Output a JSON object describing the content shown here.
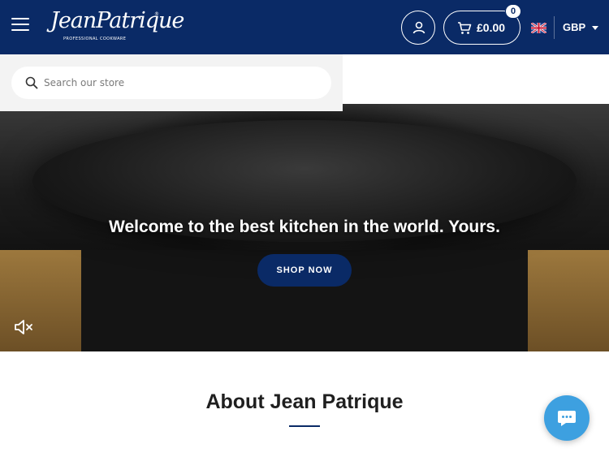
{
  "header": {
    "logo_text": "JeanPatrique",
    "logo_subtitle": "PROFESSIONAL COOKWARE",
    "logo_registered": "®",
    "cart_total": "£0.00",
    "cart_count": "0",
    "currency": "GBP",
    "menu_icon": "hamburger-menu-icon",
    "account_icon": "user-icon",
    "cart_icon": "cart-icon",
    "flag_icon": "uk-flag-icon"
  },
  "search": {
    "placeholder": "Search our store",
    "icon": "search-icon"
  },
  "hero": {
    "title": "Welcome to the best kitchen in the world. Yours.",
    "button_label": "SHOP NOW",
    "mute_icon": "speaker-muted-icon"
  },
  "about": {
    "title": "About Jean Patrique"
  },
  "chat": {
    "icon": "chat-bubble-icon"
  },
  "colors": {
    "brand_navy": "#0a2a66",
    "chat_blue": "#3da0e0"
  }
}
